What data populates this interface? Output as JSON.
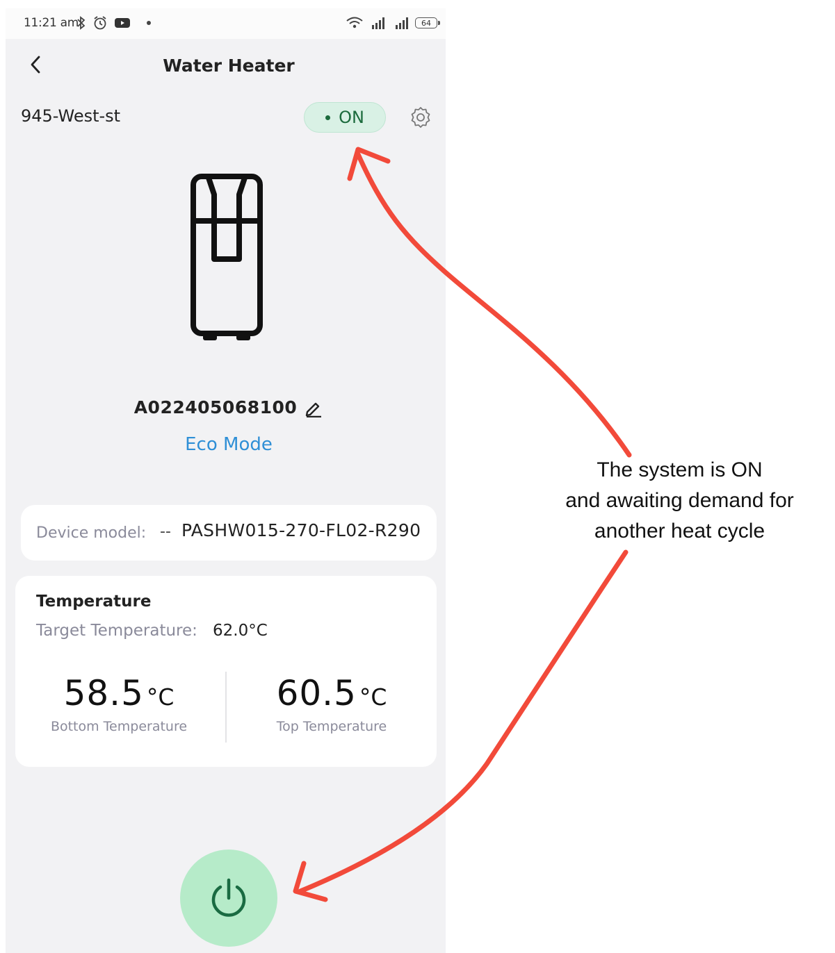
{
  "status_bar": {
    "time": "11:21 am",
    "battery": "64",
    "icons": [
      "bluetooth-icon",
      "alarm-icon",
      "youtube-icon",
      "wifi-icon",
      "signal-icon",
      "signal-icon",
      "battery-icon"
    ]
  },
  "header": {
    "title": "Water Heater"
  },
  "device": {
    "name": "945-West-st",
    "status": "ON",
    "serial": "A022405068100",
    "mode": "Eco Mode"
  },
  "model": {
    "label": "Device model:",
    "separator": "--",
    "value": "PASHW015-270-FL02-R290"
  },
  "temperature": {
    "title": "Temperature",
    "target_label": "Target Temperature:",
    "target_value": "62.0°C",
    "bottom_value": "58.5",
    "bottom_unit": "°C",
    "bottom_label": "Bottom Temperature",
    "top_value": "60.5",
    "top_unit": "°C",
    "top_label": "Top Temperature"
  },
  "annotation": {
    "line1": "The system is ON",
    "line2": "and awaiting demand for",
    "line3": "another heat cycle"
  },
  "colors": {
    "accent_green": "#1c6b3d",
    "pill_background": "#d9f1e5",
    "power_button": "#b6ebc9",
    "link_blue": "#2f8fd6",
    "arrow_red": "#f24a3a"
  }
}
